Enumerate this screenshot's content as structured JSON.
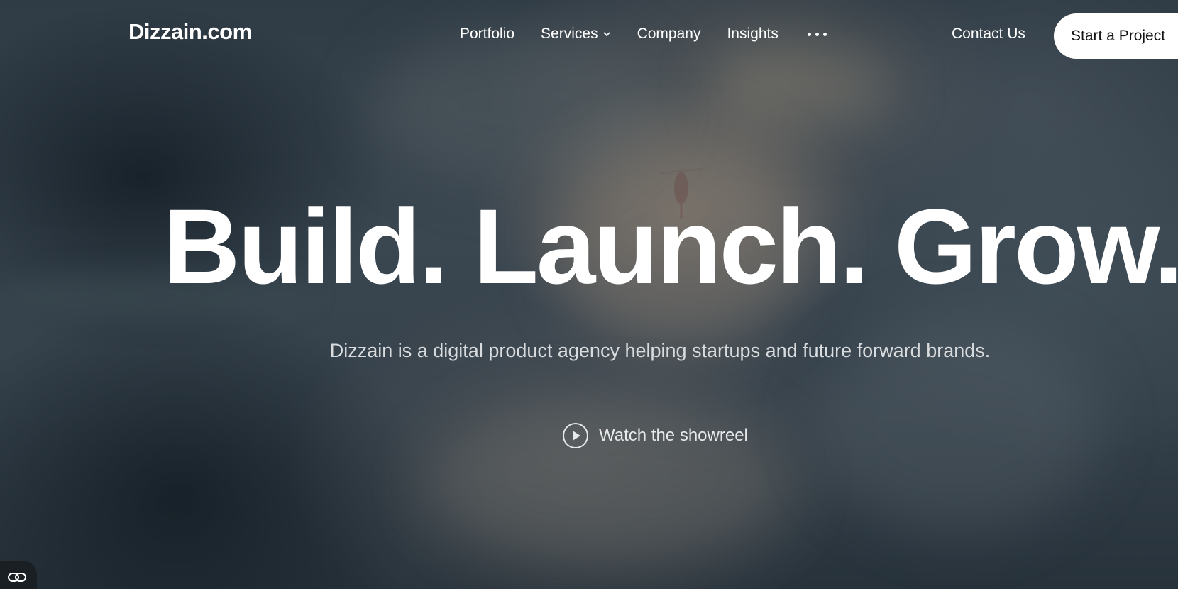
{
  "header": {
    "logo": "Dizzain.com",
    "nav": [
      {
        "label": "Portfolio"
      },
      {
        "label": "Services"
      },
      {
        "label": "Company"
      },
      {
        "label": "Insights"
      }
    ],
    "more_icon": "more-horizontal-icon",
    "contact_label": "Contact Us",
    "cta_label": "Start a Project"
  },
  "hero": {
    "title": "Build. Launch. Grow.",
    "subtitle": "Dizzain is a digital product agency helping startups and future forward brands.",
    "showreel_label": "Watch the showreel",
    "showreel_icon": "play-circle-icon"
  },
  "widget": {
    "icon": "chat-link-icon"
  },
  "colors": {
    "cta_background": "#ffffff",
    "cta_text": "#111111",
    "text_primary": "#ffffff"
  }
}
